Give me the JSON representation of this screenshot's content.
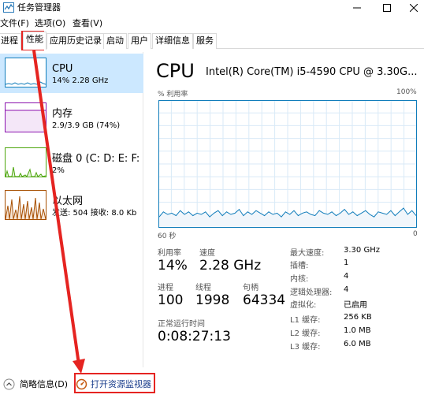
{
  "window": {
    "title": "任务管理器"
  },
  "menu": [
    "文件(F)",
    "选项(O)",
    "查看(V)"
  ],
  "tabs": [
    "进程",
    "性能",
    "应用历史记录",
    "启动",
    "用户",
    "详细信息",
    "服务"
  ],
  "active_tab": "性能",
  "sidebar": {
    "items": [
      {
        "title": "CPU",
        "subtitle": "14% 2.28 GHz",
        "color": "#117dbb",
        "selected": true
      },
      {
        "title": "内存",
        "subtitle": "2.9/3.9 GB (74%)",
        "color": "#8b12ae",
        "selected": false
      },
      {
        "title": "磁盘 0 (C: D: E: F:",
        "subtitle": "2%",
        "color": "#4da60c",
        "selected": false
      },
      {
        "title": "以太网",
        "subtitle": "发送: 504  接收: 8.0 Kb",
        "color": "#a74f01",
        "selected": false
      }
    ]
  },
  "cpu": {
    "title": "CPU",
    "model": "Intel(R) Core(TM) i5-4590 CPU @ 3.30G...",
    "util_label": "% 利用率",
    "util_max": "100%",
    "time_label": "60 秒",
    "time_zero": "0",
    "graph_color": "#117dbb",
    "stats": {
      "utilization": {
        "label": "利用率",
        "value": "14%"
      },
      "speed": {
        "label": "速度",
        "value": "2.28 GHz"
      },
      "processes": {
        "label": "进程",
        "value": "100"
      },
      "threads": {
        "label": "线程",
        "value": "1998"
      },
      "handles": {
        "label": "句柄",
        "value": "64334"
      },
      "uptime": {
        "label": "正常运行时间",
        "value": "0:08:27:13"
      }
    },
    "details": [
      {
        "label": "最大速度:",
        "value": "3.30 GHz"
      },
      {
        "label": "插槽:",
        "value": "1"
      },
      {
        "label": "内核:",
        "value": "4"
      },
      {
        "label": "逻辑处理器:",
        "value": "4"
      },
      {
        "label": "虚拟化:",
        "value": "已启用"
      },
      {
        "label": "L1 缓存:",
        "value": "256 KB"
      },
      {
        "label": "L2 缓存:",
        "value": "1.0 MB"
      },
      {
        "label": "L3 缓存:",
        "value": "6.0 MB"
      }
    ],
    "graph_values": [
      8,
      12,
      10,
      11,
      9,
      13,
      10,
      12,
      9,
      11,
      10,
      12,
      8,
      11,
      13,
      9,
      12,
      10,
      11,
      14,
      9,
      12,
      10,
      13,
      11,
      9,
      12,
      10,
      11,
      8,
      12,
      10,
      13,
      9,
      11,
      12,
      10,
      9,
      13,
      11,
      10,
      12,
      9,
      11,
      14,
      10,
      12,
      9,
      11,
      13,
      10,
      8,
      12,
      11,
      10,
      13,
      9,
      12,
      15,
      10,
      13,
      9
    ]
  },
  "footer": {
    "fewer_details": "简略信息(D)",
    "open_resmon": "打开资源监视器"
  },
  "annotation_color": "#e52421"
}
